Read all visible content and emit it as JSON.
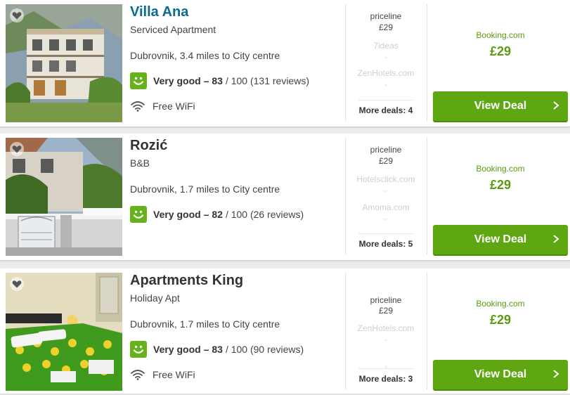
{
  "hotels": [
    {
      "name": "Villa Ana",
      "type": "Serviced Apartment",
      "location": "Dubrovnik, 3.4 miles to City centre",
      "rating_label": "Very good –",
      "rating_score": "83",
      "rating_rest": "/ 100 (131 reviews)",
      "amenity": "Free WiFi",
      "deals": {
        "top_name": "priceline",
        "top_price": "£29",
        "others": [
          "7ideas",
          "ZenHotels.com"
        ],
        "dash": "-",
        "more": "More deals: 4"
      },
      "best": {
        "provider": "Booking.com",
        "price": "£29",
        "cta": "View Deal"
      },
      "favorite_icon": "heart-icon"
    },
    {
      "name": "Rozić",
      "type": "B&B",
      "location": "Dubrovnik, 1.7 miles to City centre",
      "rating_label": "Very good –",
      "rating_score": "82",
      "rating_rest": "/ 100 (26 reviews)",
      "amenity": "",
      "deals": {
        "top_name": "priceline",
        "top_price": "£29",
        "others": [
          "Hotelsclick.com",
          "Amoma.com"
        ],
        "dash": "-",
        "more": "More deals: 5"
      },
      "best": {
        "provider": "Booking.com",
        "price": "£29",
        "cta": "View Deal"
      },
      "favorite_icon": "heart-icon"
    },
    {
      "name": "Apartments King",
      "type": "Holiday Apt",
      "location": "Dubrovnik, 1.7 miles to City centre",
      "rating_label": "Very good –",
      "rating_score": "83",
      "rating_rest": "/ 100 (90 reviews)",
      "amenity": "Free WiFi",
      "deals": {
        "top_name": "priceline",
        "top_price": "£29",
        "others": [
          "ZenHotels.com",
          ""
        ],
        "dash": "-",
        "more": "More deals: 3"
      },
      "best": {
        "provider": "Booking.com",
        "price": "£29",
        "cta": "View Deal"
      },
      "favorite_icon": "heart-icon"
    }
  ],
  "colors": {
    "accent_green": "#5fa712",
    "rating_green": "#67b21b",
    "link_blue": "#0b6a8f"
  }
}
